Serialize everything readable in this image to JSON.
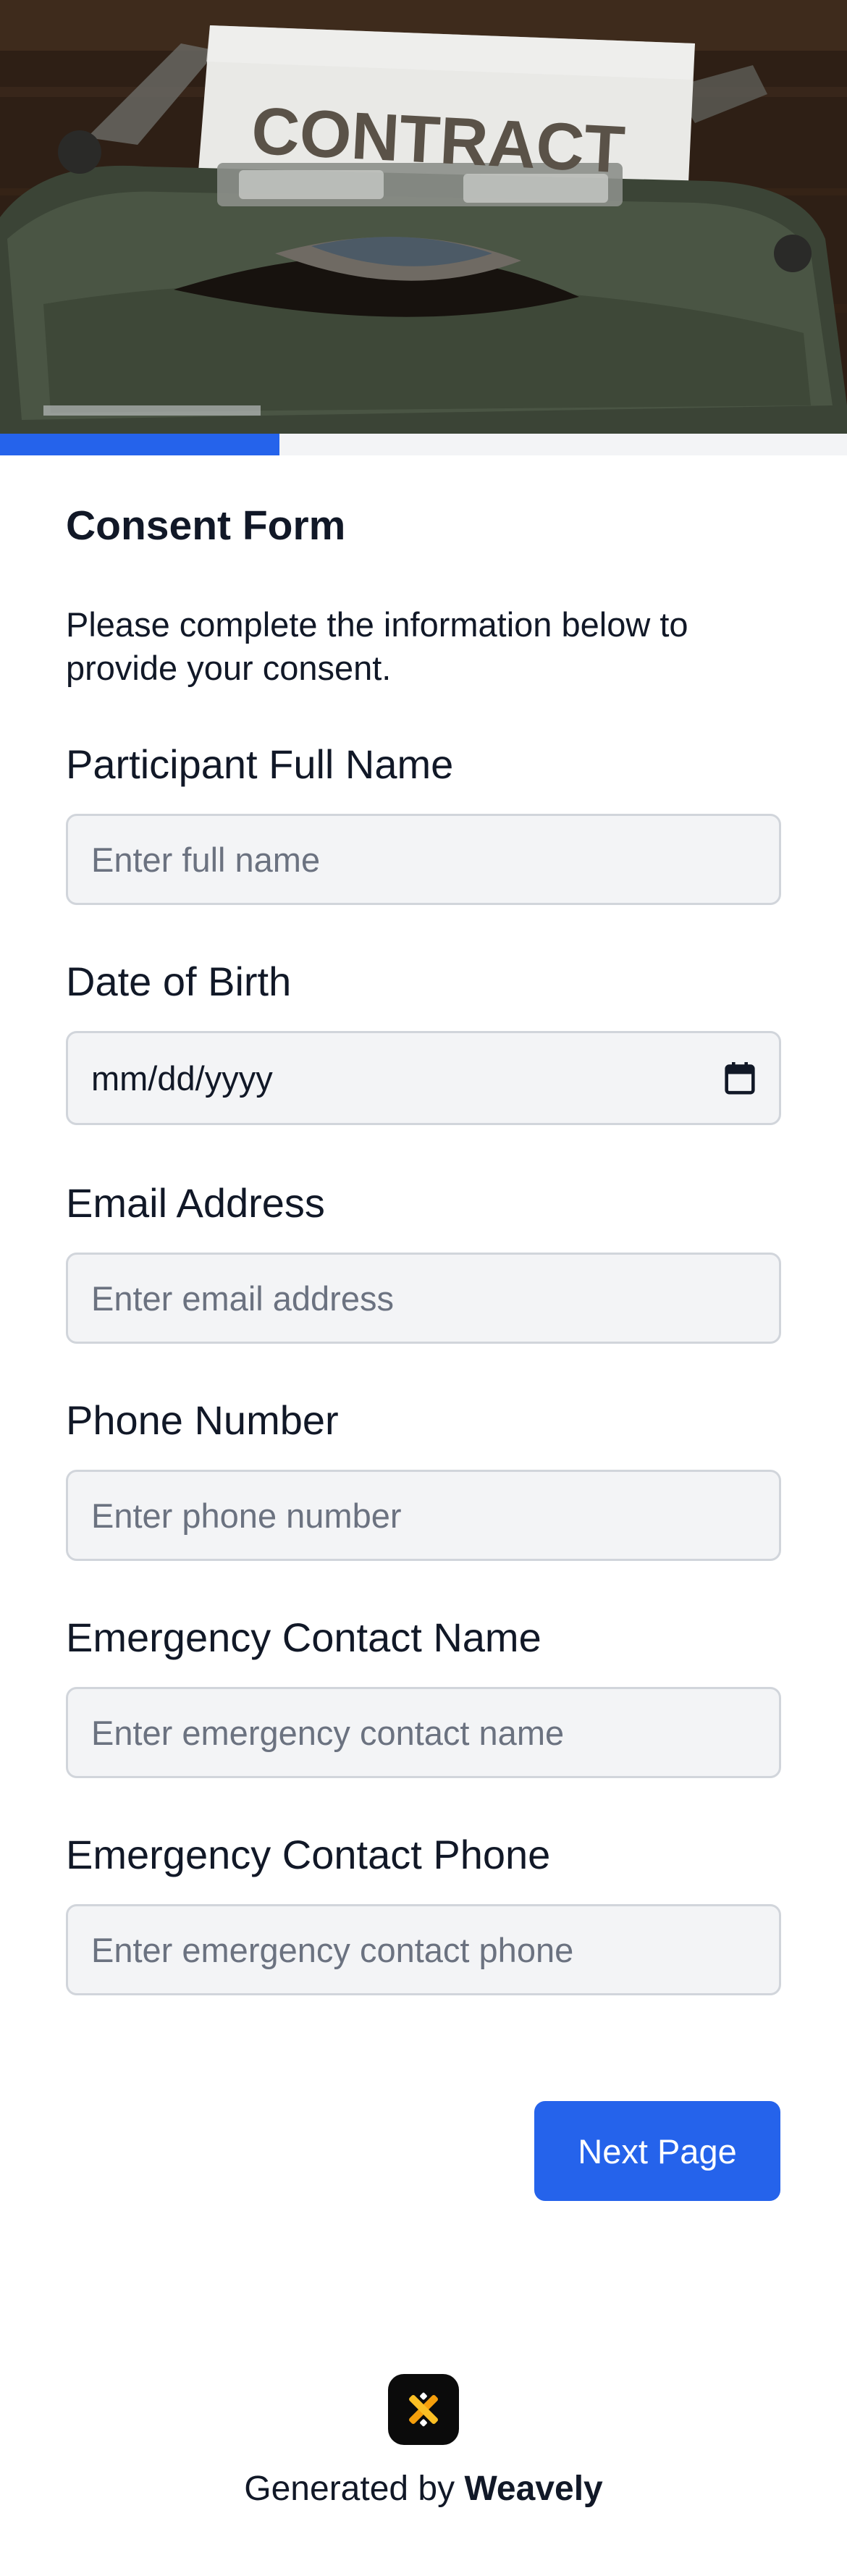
{
  "hero": {
    "image_text": "CONTRACT"
  },
  "progress": {
    "fraction": 0.33,
    "color": "#2563eb"
  },
  "form": {
    "title": "Consent Form",
    "description": "Please complete the information below to provide your consent.",
    "fields": [
      {
        "label": "Participant Full Name",
        "placeholder": "Enter full name",
        "type": "text"
      },
      {
        "label": "Date of Birth",
        "value": "mm/dd/yyyy",
        "type": "date",
        "icon": "calendar-icon"
      },
      {
        "label": "Email Address",
        "placeholder": "Enter email address",
        "type": "email"
      },
      {
        "label": "Phone Number",
        "placeholder": "Enter phone number",
        "type": "tel"
      },
      {
        "label": "Emergency Contact Name",
        "placeholder": "Enter emergency contact name",
        "type": "text"
      },
      {
        "label": "Emergency Contact Phone",
        "placeholder": "Enter emergency contact phone",
        "type": "tel"
      }
    ],
    "next_button_label": "Next Page"
  },
  "footer": {
    "prefix": "Generated by ",
    "brand": "Weavely",
    "logo_icon": "weavely-logo-icon"
  },
  "colors": {
    "accent": "#2563eb",
    "input_bg": "#f3f4f6",
    "input_border": "#d1d5db",
    "text": "#111827",
    "placeholder": "#6b7280"
  }
}
